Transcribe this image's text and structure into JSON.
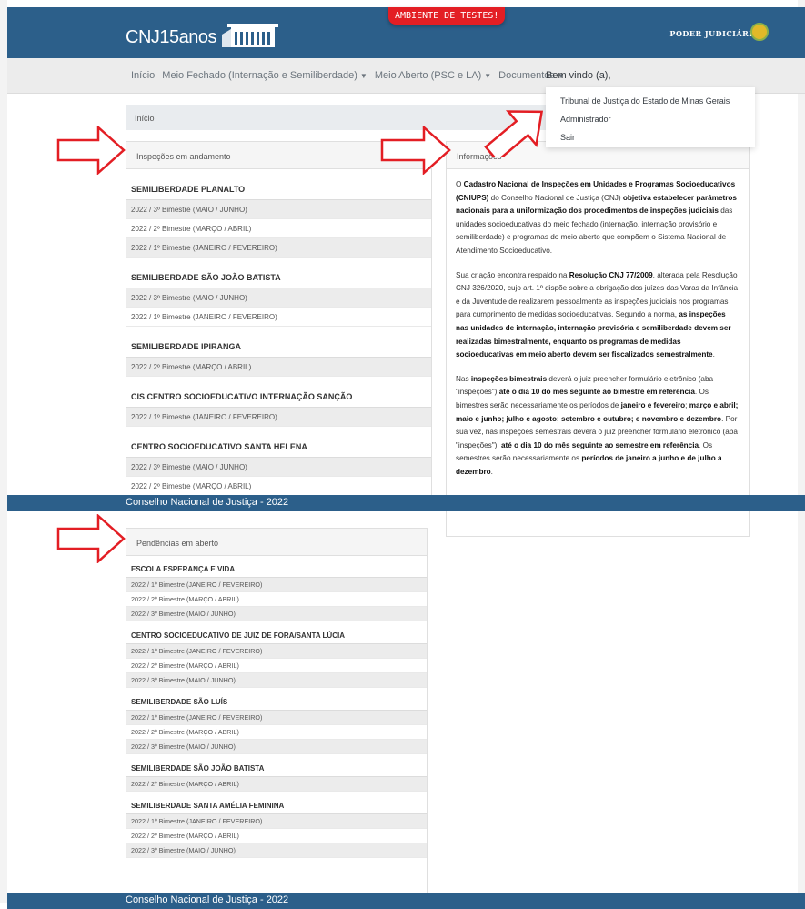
{
  "header": {
    "logo_text": "CNJ",
    "logo_sub": "15anos",
    "env_badge": "AMBIENTE DE TESTES!",
    "poder": "PODER JUDICIÁRIO"
  },
  "nav": {
    "items": [
      "Início",
      "Meio Fechado (Internação e Semiliberdade)",
      "Meio Aberto (PSC e LA)",
      "Documentos"
    ],
    "welcome": "Bem vindo (a),"
  },
  "dropdown": {
    "items": [
      "Tribunal de Justiça do Estado de Minas Gerais",
      "Administrador",
      "Sair"
    ]
  },
  "breadcrumb": "Início",
  "in_progress": {
    "title": "Inspeções em andamento",
    "units": [
      {
        "name": "SEMILIBERDADE PLANALTO",
        "periods": [
          "2022 / 3º Bimestre (MAIO / JUNHO)",
          "2022 / 2º Bimestre (MARÇO / ABRIL)",
          "2022 / 1º Bimestre (JANEIRO / FEVEREIRO)"
        ]
      },
      {
        "name": "SEMILIBERDADE SÃO JOÃO BATISTA",
        "periods": [
          "2022 / 3º Bimestre (MAIO / JUNHO)",
          "2022 / 1º Bimestre (JANEIRO / FEVEREIRO)"
        ]
      },
      {
        "name": "SEMILIBERDADE IPIRANGA",
        "periods": [
          "2022 / 2º Bimestre (MARÇO / ABRIL)"
        ]
      },
      {
        "name": "CIS CENTRO SOCIOEDUCATIVO INTERNAÇÃO SANÇÃO",
        "periods": [
          "2022 / 1º Bimestre (JANEIRO / FEVEREIRO)"
        ]
      },
      {
        "name": "CENTRO SOCIOEDUCATIVO SANTA HELENA",
        "periods": [
          "2022 / 3º Bimestre (MAIO / JUNHO)",
          "2022 / 2º Bimestre (MARÇO / ABRIL)"
        ]
      }
    ]
  },
  "info": {
    "title": "Informações",
    "p1": [
      {
        "t": "O ",
        "b": false
      },
      {
        "t": "Cadastro Nacional de Inspeções em Unidades e Programas Socioeducativos (CNIUPS)",
        "b": true
      },
      {
        "t": " do Conselho Nacional de Justiça (CNJ) ",
        "b": false
      },
      {
        "t": "objetiva estabelecer parâmetros nacionais para a uniformização dos procedimentos de inspeções judiciais",
        "b": true
      },
      {
        "t": " das unidades socioeducativas do meio fechado (internação, internação provisório e semiliberdade) e programas do meio aberto que compõem o Sistema Nacional de Atendimento Socioeducativo.",
        "b": false
      }
    ],
    "p2": [
      {
        "t": "Sua criação encontra respaldo na ",
        "b": false
      },
      {
        "t": "Resolução CNJ 77/2009",
        "b": true
      },
      {
        "t": ", alterada pela Resolução CNJ 326/2020, cujo art. 1º dispõe sobre a obrigação dos juízes das Varas da Infância e da Juventude de realizarem pessoalmente as inspeções judiciais nos programas para cumprimento de medidas socioeducativas. Segundo a norma, ",
        "b": false
      },
      {
        "t": "as inspeções nas unidades de internação, internação provisória e semiliberdade devem ser realizadas bimestralmente, enquanto os programas de medidas socioeducativas em meio aberto devem ser fiscalizados semestralmente",
        "b": true
      },
      {
        "t": ".",
        "b": false
      }
    ],
    "p3": [
      {
        "t": "Nas ",
        "b": false
      },
      {
        "t": "inspeções bimestrais",
        "b": true
      },
      {
        "t": " deverá o juiz preencher formulário eletrônico (aba \"inspeções\") ",
        "b": false
      },
      {
        "t": "até o dia 10 do mês seguinte ao bimestre em referência",
        "b": true
      },
      {
        "t": ". Os bimestres serão necessariamente os períodos de ",
        "b": false
      },
      {
        "t": "janeiro e fevereiro",
        "b": true
      },
      {
        "t": "; ",
        "b": false
      },
      {
        "t": "março e abril; maio e junho; julho e agosto; setembro e outubro; e novembro e dezembro",
        "b": true
      },
      {
        "t": ". Por sua vez, nas inspeções semestrais deverá o juiz preencher formulário eletrônico (aba \"inspeções\"), ",
        "b": false
      },
      {
        "t": "até o dia 10 do mês seguinte ao semestre em referência",
        "b": true
      },
      {
        "t": ". Os semestres serão necessariamente os ",
        "b": false
      },
      {
        "t": "períodos de janeiro a junho e de julho a dezembro",
        "b": true
      },
      {
        "t": ".",
        "b": false
      }
    ]
  },
  "footer": "Conselho Nacional de Justiça - 2022",
  "pending": {
    "title": "Pendências em aberto",
    "units": [
      {
        "name": "ESCOLA ESPERANÇA E VIDA",
        "periods": [
          "2022 / 1º Bimestre (JANEIRO / FEVEREIRO)",
          "2022 / 2º Bimestre (MARÇO / ABRIL)",
          "2022 / 3º Bimestre (MAIO / JUNHO)"
        ]
      },
      {
        "name": "CENTRO SOCIOEDUCATIVO DE JUIZ DE FORA/SANTA LÚCIA",
        "periods": [
          "2022 / 1º Bimestre (JANEIRO / FEVEREIRO)",
          "2022 / 2º Bimestre (MARÇO / ABRIL)",
          "2022 / 3º Bimestre (MAIO / JUNHO)"
        ]
      },
      {
        "name": "SEMILIBERDADE SÃO LUÍS",
        "periods": [
          "2022 / 1º Bimestre (JANEIRO / FEVEREIRO)",
          "2022 / 2º Bimestre (MARÇO / ABRIL)",
          "2022 / 3º Bimestre (MAIO / JUNHO)"
        ]
      },
      {
        "name": "SEMILIBERDADE SÃO JOÃO BATISTA",
        "periods": [
          "2022 / 2º Bimestre (MARÇO / ABRIL)"
        ]
      },
      {
        "name": "SEMILIBERDADE SANTA AMÉLIA FEMININA",
        "periods": [
          "2022 / 1º Bimestre (JANEIRO / FEVEREIRO)",
          "2022 / 2º Bimestre (MARÇO / ABRIL)",
          "2022 / 3º Bimestre (MAIO / JUNHO)"
        ]
      }
    ]
  },
  "colors": {
    "header": "#2c5f8a",
    "badge": "#e31e24",
    "arrow": "#e31e24"
  }
}
